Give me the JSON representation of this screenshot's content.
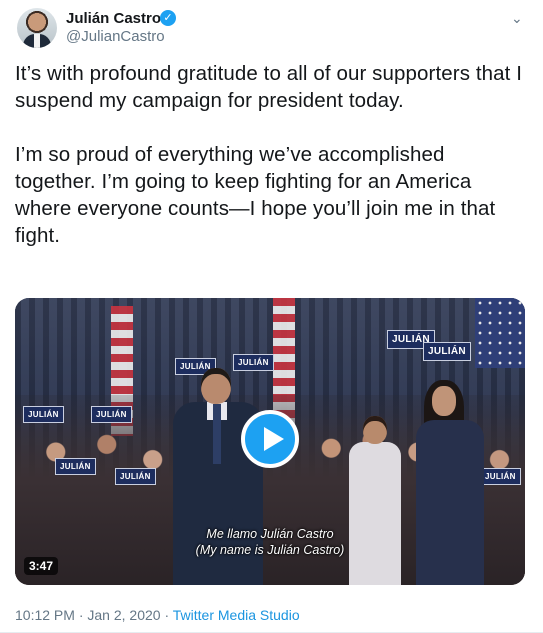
{
  "author": {
    "display_name": "Julián Castro",
    "handle": "@JulianCastro",
    "verified_icon": "verified-badge-icon",
    "avatar_icon": "profile-avatar"
  },
  "menu_icon": "chevron-down-icon",
  "tweet": {
    "text": "It’s with profound gratitude to all of our supporters that I suspend my campaign for president today.\n\nI’m so proud of everything we’ve accomplished together. I’m going to keep fighting for an America where everyone counts—I hope you’ll join me in that fight."
  },
  "media": {
    "type": "video",
    "duration": "3:47",
    "subtitle_line1": "Me llamo Julián Castro",
    "subtitle_line2": "(My name is Julián Castro)",
    "sign_text": "JULIÁN",
    "play_icon": "play-icon",
    "colors": {
      "play_button": "#1da1f2",
      "sign_bg": "#1d2d5e"
    }
  },
  "footer": {
    "time": "10:12 PM",
    "separator": " · ",
    "date": "Jan 2, 2020",
    "source": "Twitter Media Studio"
  },
  "colors": {
    "link": "#1b95e0",
    "secondary_text": "#657786",
    "primary_text": "#14171a"
  }
}
